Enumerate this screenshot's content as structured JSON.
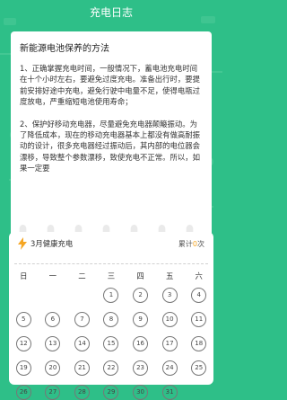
{
  "header": {
    "title": "充电日志"
  },
  "article": {
    "title": "新能源电池保养的方法",
    "paragraphs": [
      "1、正确掌握充电时间，一般情况下，蓄电池充电时间在十个小时左右，要避免过度充电。准备出行时，要提前安排好途中充电，避免行驶中电量不足，使得电瓶过度放电，严重缩短电池使用寿命；",
      "2、保护好移动充电器，尽量避免充电器颠簸振动。为了降低成本，现在的移动充电器基本上都没有做高耐振动的设计，很多充电器经过振动后，其内部的电位器会漂移，导致整个参数漂移，致使充电不正常。所以，如果一定要"
    ]
  },
  "calendar": {
    "month_label": "3月健康充电",
    "total_label": "累计",
    "total_count": "0",
    "total_unit": "次",
    "weekdays": [
      "日",
      "一",
      "二",
      "三",
      "四",
      "五",
      "六"
    ],
    "days": [
      "1",
      "2",
      "3",
      "4",
      "5",
      "6",
      "7",
      "8",
      "9",
      "10",
      "11",
      "12",
      "13",
      "14",
      "15",
      "16",
      "17",
      "18",
      "19",
      "20",
      "21",
      "22",
      "23",
      "24",
      "25",
      "26",
      "27",
      "28",
      "29",
      "30",
      "31"
    ],
    "first_weekday_index": 3
  },
  "colors": {
    "background": "#2ebf88",
    "accent": "#f5a623"
  },
  "icons": {
    "month": "lightning-bolt-icon"
  }
}
